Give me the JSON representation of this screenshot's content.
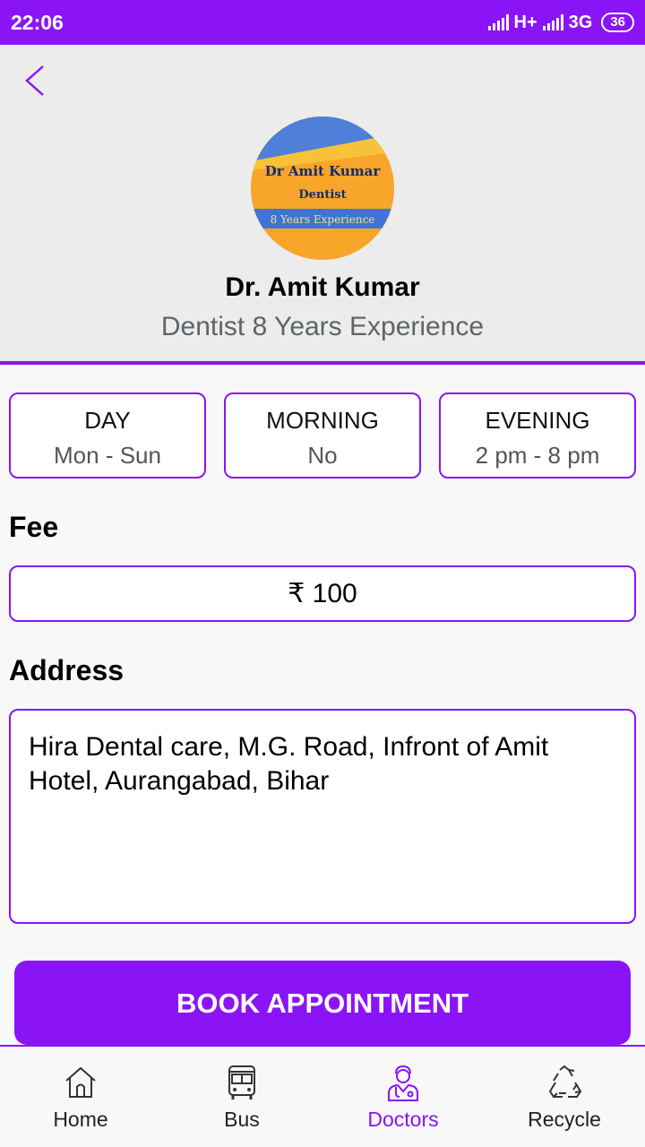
{
  "status_bar": {
    "time": "22:06",
    "network_1": "H+",
    "network_2": "3G",
    "battery": "36"
  },
  "profile": {
    "avatar_lines": [
      "Dr Amit Kumar",
      "Dentist",
      "8 Years Experience"
    ],
    "name": "Dr. Amit Kumar",
    "subtitle": "Dentist 8 Years Experience"
  },
  "timings": [
    {
      "title": "DAY",
      "value": "Mon - Sun"
    },
    {
      "title": "MORNING",
      "value": "No"
    },
    {
      "title": "EVENING",
      "value": "2 pm - 8 pm"
    }
  ],
  "fee": {
    "label": "Fee",
    "value": "₹ 100"
  },
  "address": {
    "label": "Address",
    "value": "Hira Dental care, M.G. Road, Infront of Amit Hotel, Aurangabad, Bihar"
  },
  "book_button": "BOOK APPOINTMENT",
  "nav": [
    {
      "label": "Home",
      "icon": "home-icon"
    },
    {
      "label": "Bus",
      "icon": "bus-icon"
    },
    {
      "label": "Doctors",
      "icon": "doctor-icon",
      "active": true
    },
    {
      "label": "Recycle",
      "icon": "recycle-icon"
    }
  ],
  "colors": {
    "accent": "#8a14f6",
    "header_bg": "#ececec",
    "subtitle": "#5e6468"
  }
}
